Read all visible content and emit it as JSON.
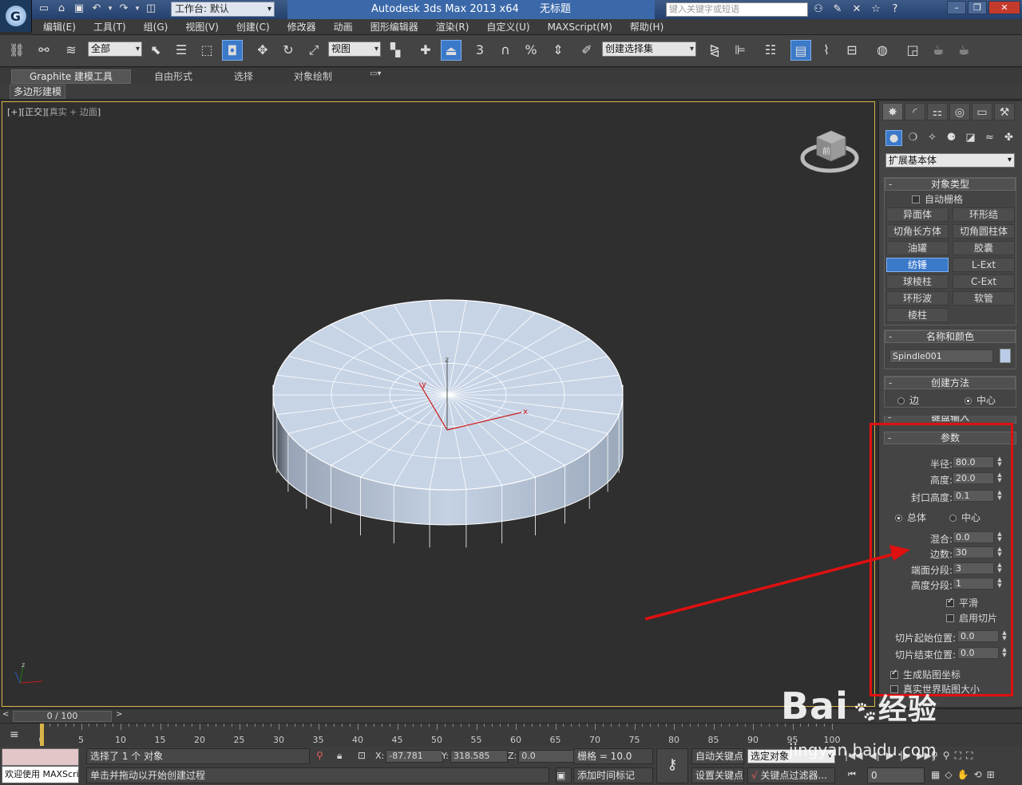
{
  "titlebar": {
    "workspace": "工作台: 默认",
    "app_title": "Autodesk 3ds Max  2013 x64",
    "doc_title": "无标题",
    "search_placeholder": "键入关键字或短语"
  },
  "menu": [
    "编辑(E)",
    "工具(T)",
    "组(G)",
    "视图(V)",
    "创建(C)",
    "修改器",
    "动画",
    "图形编辑器",
    "渲染(R)",
    "自定义(U)",
    "MAXScript(M)",
    "帮助(H)"
  ],
  "toolbar": {
    "filter_value": "全部",
    "ref_coord_value": "视图",
    "selection_set_value": "创建选择集",
    "snap_angle_label": "3",
    "percent_label": "%"
  },
  "ribbon": {
    "tabs": [
      "Graphite 建模工具",
      "自由形式",
      "选择",
      "对象绘制"
    ],
    "sub_label": "多边形建模"
  },
  "viewport": {
    "label_prefix": "[+][",
    "label_view": "正交",
    "label_mid": "][",
    "label_shade": "真实 + 边面",
    "label_end": "]",
    "viewcube_face": "前"
  },
  "command_panel": {
    "category": "扩展基本体",
    "object_type": {
      "title": "对象类型",
      "autogrid_label": "自动栅格",
      "buttons": [
        "异面体",
        "环形结",
        "切角长方体",
        "切角圆柱体",
        "油罐",
        "胶囊",
        "纺锤",
        "L-Ext",
        "球棱柱",
        "C-Ext",
        "环形波",
        "软管",
        "棱柱"
      ],
      "active": "纺锤"
    },
    "name_color": {
      "title": "名称和颜色",
      "name_value": "Spindle001",
      "swatch_color": "#b9cdea"
    },
    "creation_method": {
      "title": "创建方法",
      "edge_label": "边",
      "center_label": "中心",
      "selected": "中心"
    },
    "keyboard_entry_title": "键盘输入",
    "parameters": {
      "title": "参数",
      "radius_label": "半径:",
      "radius": "80.0",
      "height_label": "高度:",
      "height": "20.0",
      "cap_height_label": "封口高度:",
      "cap_height": "0.1",
      "overall_label": "总体",
      "center_label": "中心",
      "blend_label": "混合:",
      "blend": "0.0",
      "sides_label": "边数:",
      "sides": "30",
      "cap_segs_label": "端面分段:",
      "cap_segs": "3",
      "height_segs_label": "高度分段:",
      "height_segs": "1",
      "smooth_label": "平滑",
      "slice_on_label": "启用切片",
      "slice_from_label": "切片起始位置:",
      "slice_from": "0.0",
      "slice_to_label": "切片结束位置:",
      "slice_to": "0.0",
      "gen_mapping_label": "生成贴图坐标",
      "real_world_label": "真实世界贴图大小"
    }
  },
  "timeline": {
    "frame_display": "0 / 100",
    "ticks": [
      0,
      5,
      10,
      15,
      20,
      25,
      30,
      35,
      40,
      45,
      50,
      55,
      60,
      65,
      70,
      75,
      80,
      85,
      90,
      95,
      100
    ]
  },
  "status": {
    "maxscript_text": "欢迎使用 MAXScri",
    "selected_text": "选择了 1 个 对象",
    "prompt_text": "单击并拖动以开始创建过程",
    "x_label": "X:",
    "x": "-87.781",
    "y_label": "Y:",
    "y": "318.585",
    "z_label": "Z:",
    "z": "0.0",
    "grid": "栅格 = 10.0",
    "auto_key": "自动关键点",
    "set_key": "设置关键点",
    "selected_object": "选定对象",
    "key_filters": "关键点过滤器...",
    "add_time_tag": "添加时间标记",
    "current_frame": "0"
  },
  "watermark": {
    "brand": "Bai",
    "brand_suffix": "经验",
    "url": "jingyan.baidu.com"
  }
}
